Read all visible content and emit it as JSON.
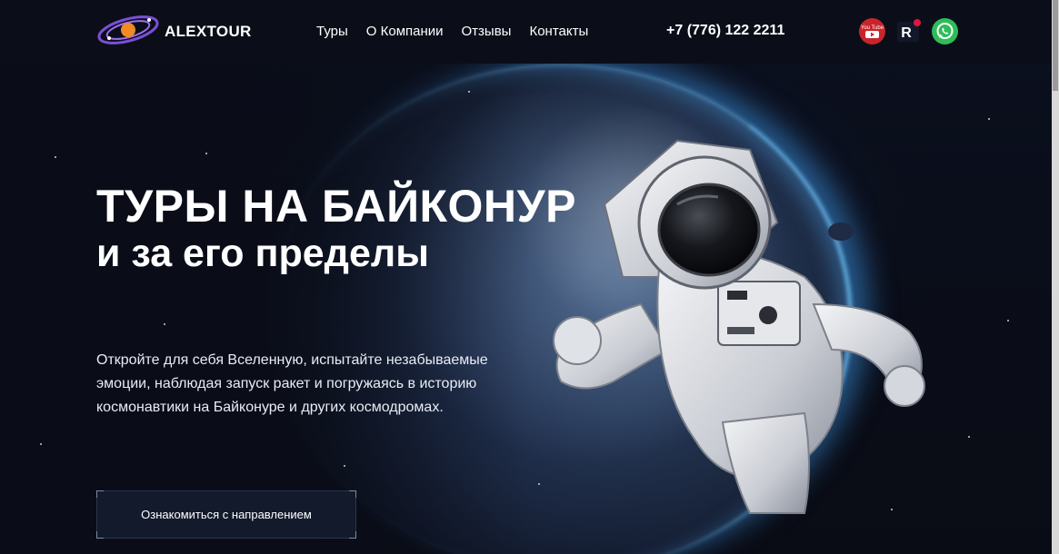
{
  "header": {
    "brand": "ALEXTOUR",
    "nav": [
      "Туры",
      "О Компании",
      "Отзывы",
      "Контакты"
    ],
    "phone": "+7 (776) 122 2211",
    "social": [
      {
        "icon": "youtube-icon",
        "label": "You Tube",
        "color": "#c8252b"
      },
      {
        "icon": "rutube-icon",
        "label": "R",
        "color": "#e0163d"
      },
      {
        "icon": "whatsapp-icon",
        "color": "#2ebd59"
      }
    ]
  },
  "hero": {
    "title_line1": "ТУРЫ НА БАЙКОНУР",
    "title_line2": "и за его пределы",
    "description": "Откройте для себя Вселенную, испытайте незабываемые эмоции, наблюдая запуск ракет и погружаясь в историю космонавтики на Байконуре и других космодромах.",
    "cta_label": "Ознакомиться с направлением"
  },
  "colors": {
    "background": "#0a0e1a",
    "accent_purple": "#7b4fd6",
    "accent_orange": "#f08a24",
    "button_bg": "#121a2c"
  }
}
